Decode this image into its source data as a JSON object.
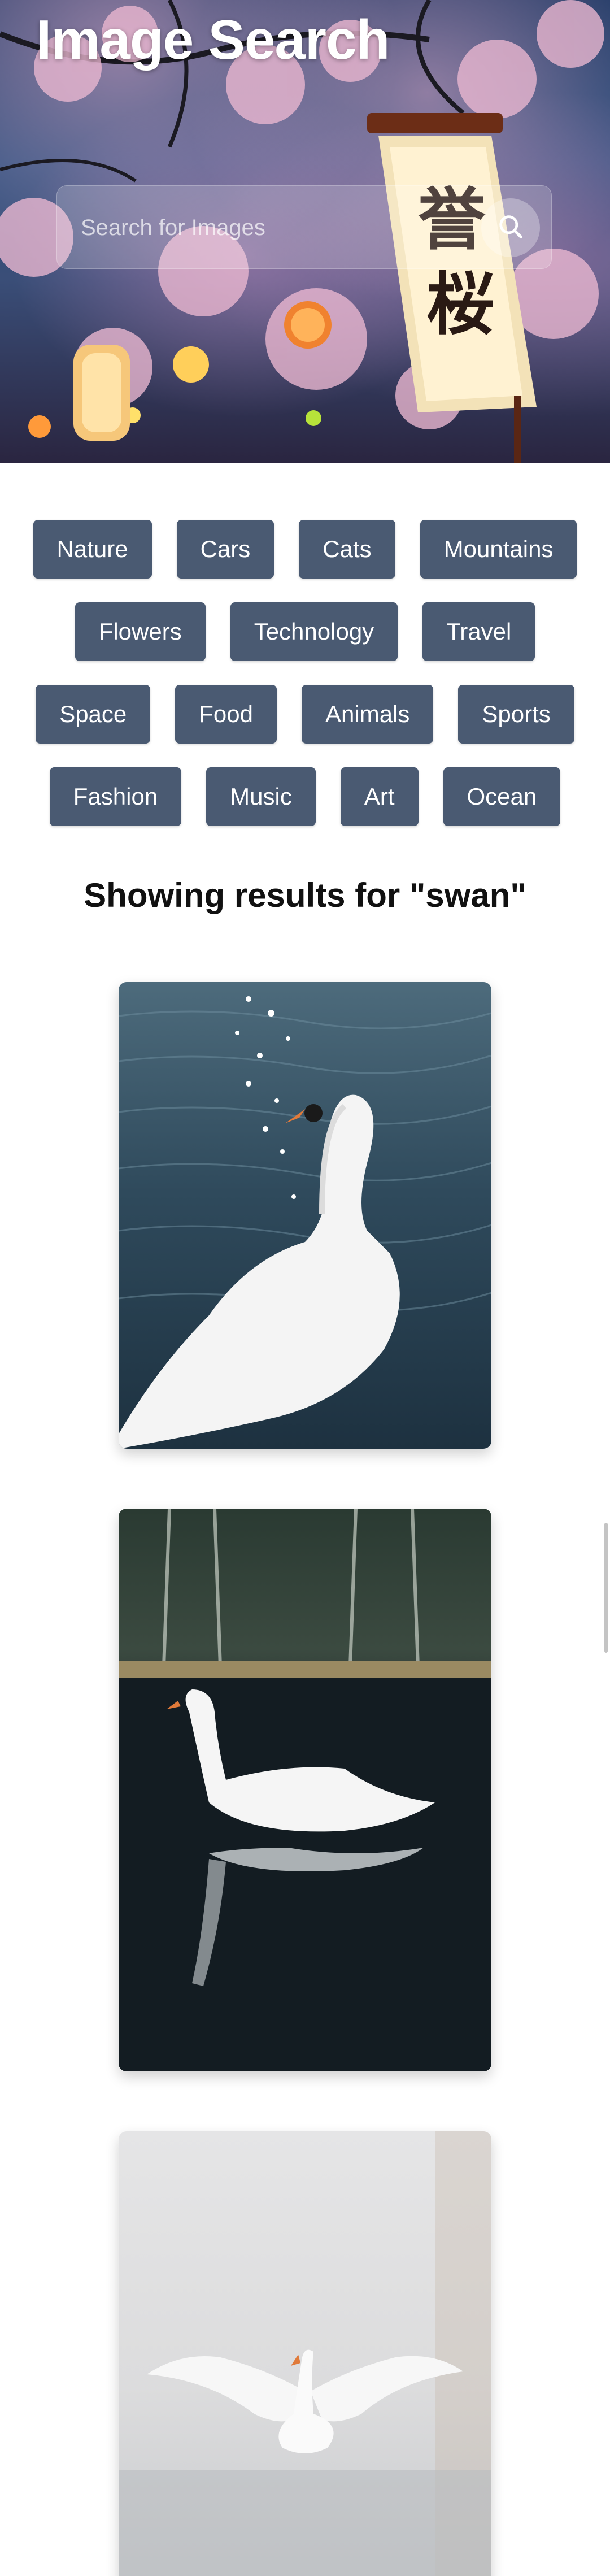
{
  "hero": {
    "title": "Image Search",
    "search_placeholder": "Search for Images",
    "search_value": "",
    "search_icon": "search-icon"
  },
  "categories": {
    "row1": [
      "Nature",
      "Cars",
      "Cats",
      "Mountains"
    ],
    "row2": [
      "Flowers",
      "Technology",
      "Travel"
    ],
    "row3": [
      "Space",
      "Food",
      "Animals",
      "Sports"
    ],
    "row4": [
      "Fashion",
      "Music",
      "Art",
      "Ocean"
    ]
  },
  "results": {
    "heading": "Showing results for \"swan\"",
    "images": [
      "swan-on-sparkling-water",
      "swan-with-reflection-on-lake",
      "swan-spreading-wings-in-mist"
    ]
  },
  "colors": {
    "chip_bg": "#4a5a72",
    "chip_text": "#ffffff",
    "heading_text": "#111111"
  }
}
